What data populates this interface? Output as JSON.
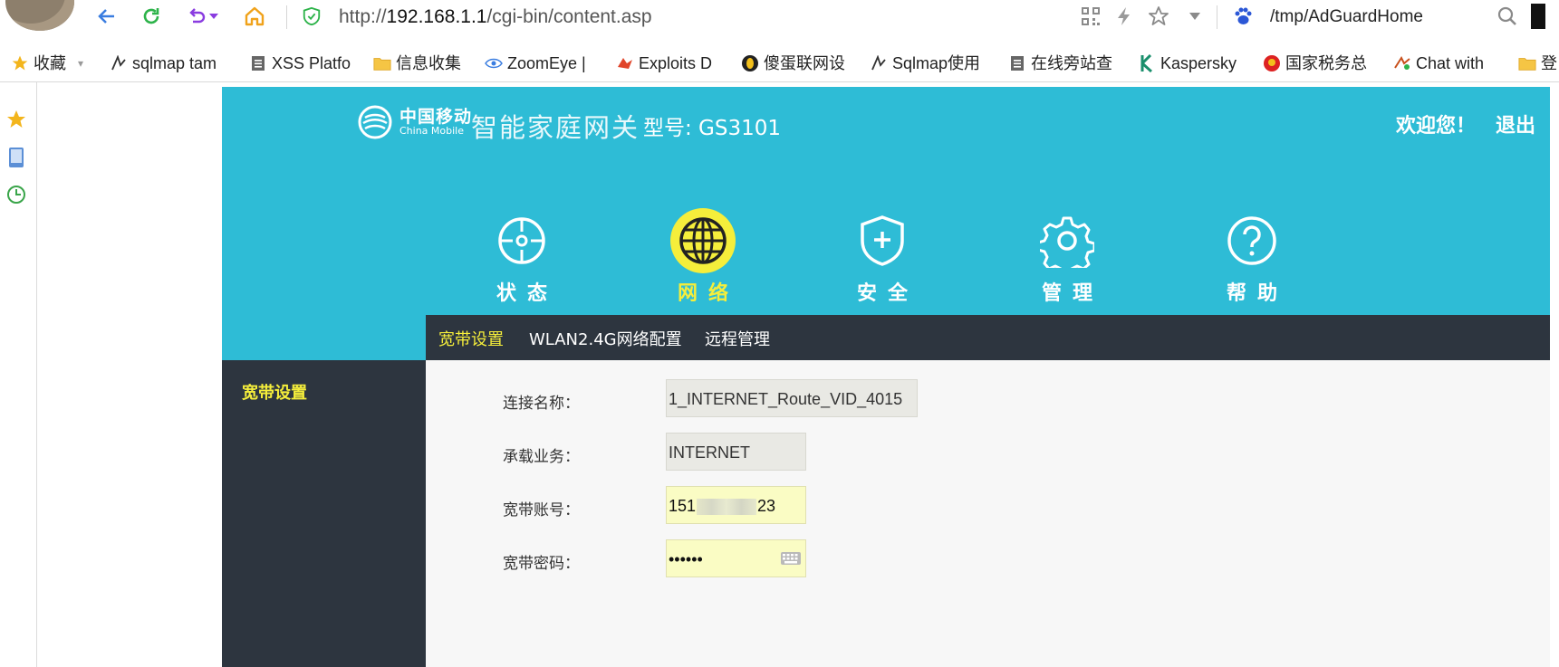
{
  "browser": {
    "url_prefix": "http://",
    "url_host": "192.168.1.1",
    "url_path": "/cgi-bin/content.asp",
    "search_query": "/tmp/AdGuardHome",
    "bookmarks": [
      {
        "label": "收藏",
        "icon": "star-icon"
      },
      {
        "label": "sqlmap tam",
        "icon": "sqlmap-icon"
      },
      {
        "label": "XSS Platfo",
        "icon": "page-icon"
      },
      {
        "label": "信息收集",
        "icon": "folder-icon"
      },
      {
        "label": "ZoomEye |",
        "icon": "eye-icon"
      },
      {
        "label": "Exploits D",
        "icon": "exploit-icon"
      },
      {
        "label": "傻蛋联网设",
        "icon": "egg-icon"
      },
      {
        "label": "Sqlmap使用",
        "icon": "sqlmap-icon"
      },
      {
        "label": "在线旁站查",
        "icon": "page-icon"
      },
      {
        "label": "Kaspersky",
        "icon": "kaspersky-icon"
      },
      {
        "label": "国家税务总",
        "icon": "emblem-icon"
      },
      {
        "label": "Chat with",
        "icon": "chat-icon"
      },
      {
        "label": "登",
        "icon": "folder-icon"
      }
    ]
  },
  "router": {
    "brand_cn": "中国移动",
    "brand_en": "China Mobile",
    "gateway_title": "智能家庭网关",
    "model": "型号: GS3101",
    "welcome": "欢迎您！",
    "logout": "退出",
    "tabs": [
      {
        "label": "状态",
        "icon": "status-icon",
        "active": false
      },
      {
        "label": "网络",
        "icon": "globe-icon",
        "active": true
      },
      {
        "label": "安全",
        "icon": "shield-icon",
        "active": false
      },
      {
        "label": "管理",
        "icon": "gear-icon",
        "active": false
      },
      {
        "label": "帮助",
        "icon": "help-icon",
        "active": false
      }
    ],
    "subnav": [
      "宽带设置",
      "WLAN2.4G网络配置",
      "远程管理"
    ],
    "left_menu": [
      "宽带设置"
    ],
    "form": {
      "connection_name_label": "连接名称：",
      "connection_name_value": "1_INTERNET_Route_VID_4015",
      "service_label": "承载业务：",
      "service_value": "INTERNET",
      "account_label": "宽带账号：",
      "account_value_start": "151",
      "account_value_end": "23",
      "password_label": "宽带密码：",
      "password_value": "••••••"
    },
    "colors": {
      "header": "#2ebcd6",
      "dark": "#2d353f",
      "accent_yellow": "#f5ee3b"
    }
  }
}
